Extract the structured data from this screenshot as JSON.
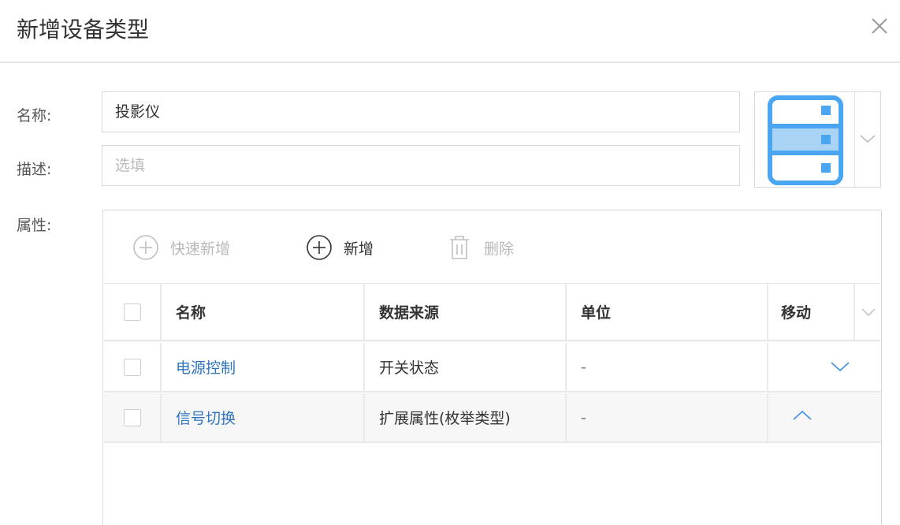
{
  "dialog": {
    "title": "新增设备类型"
  },
  "form": {
    "name_label": "名称:",
    "name_value": "投影仪",
    "desc_label": "描述:",
    "desc_placeholder": "选填",
    "attr_label": "属性:"
  },
  "icon_picker": {
    "icon": "server-icon",
    "accent": "#4aa6f0"
  },
  "toolbar": {
    "quick_add_label": "快速新增",
    "add_label": "新增",
    "delete_label": "删除"
  },
  "table": {
    "columns": [
      "名称",
      "数据来源",
      "单位",
      "移动"
    ],
    "rows": [
      {
        "name": "电源控制",
        "source": "开关状态",
        "unit": "-",
        "move": "down"
      },
      {
        "name": "信号切换",
        "source": "扩展属性(枚举类型)",
        "unit": "-",
        "move": "up"
      }
    ]
  },
  "colors": {
    "link": "#2f74c0",
    "accent": "#4aa6f0",
    "disabled": "#b8b8b8"
  }
}
